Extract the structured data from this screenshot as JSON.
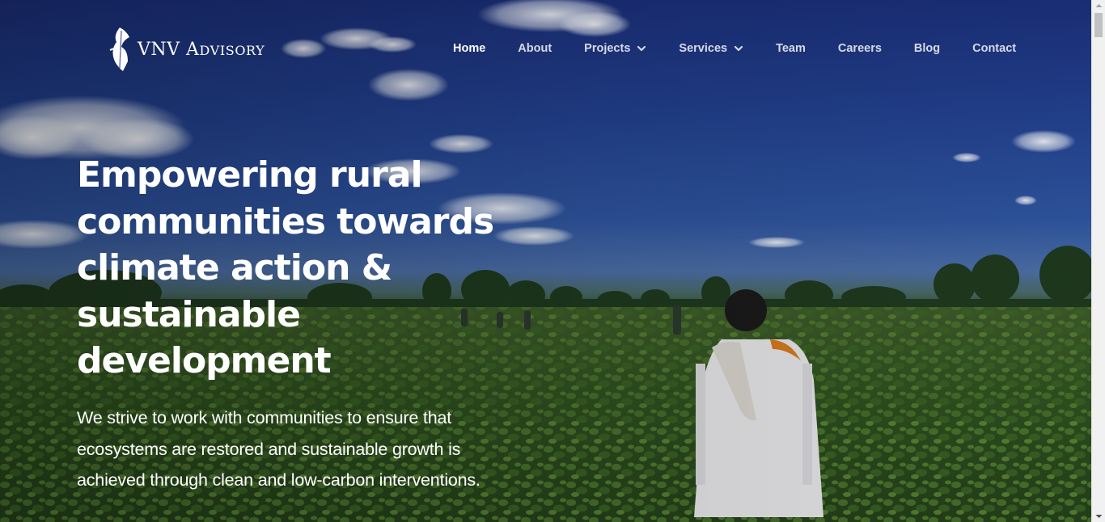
{
  "brand": {
    "logo_icon": "feather-logo-icon",
    "name_main": "VNV ",
    "name_smallcaps": "Advisory"
  },
  "nav": {
    "items": [
      {
        "label": "Home",
        "active": true,
        "has_dropdown": false
      },
      {
        "label": "About",
        "active": false,
        "has_dropdown": false
      },
      {
        "label": "Projects",
        "active": false,
        "has_dropdown": true
      },
      {
        "label": "Services",
        "active": false,
        "has_dropdown": true
      },
      {
        "label": "Team",
        "active": false,
        "has_dropdown": false
      },
      {
        "label": "Careers",
        "active": false,
        "has_dropdown": false
      },
      {
        "label": "Blog",
        "active": false,
        "has_dropdown": false
      },
      {
        "label": "Contact",
        "active": false,
        "has_dropdown": false
      }
    ],
    "dropdown_icon": "chevron-down-icon"
  },
  "hero": {
    "title": "Empowering rural communities towards climate action & sustainable development",
    "subtitle": "We strive to work with communities to ensure that ecosystems are restored and sustainable growth is achieved through clean and low-carbon interventions.",
    "background": "farmer walking through green crop field under blue sky"
  },
  "colors": {
    "sky": "#22418f",
    "field": "#2a461c",
    "text": "#ffffff",
    "scrollbar_track": "#f1f1f1",
    "scrollbar_thumb": "#c1c1c1"
  }
}
